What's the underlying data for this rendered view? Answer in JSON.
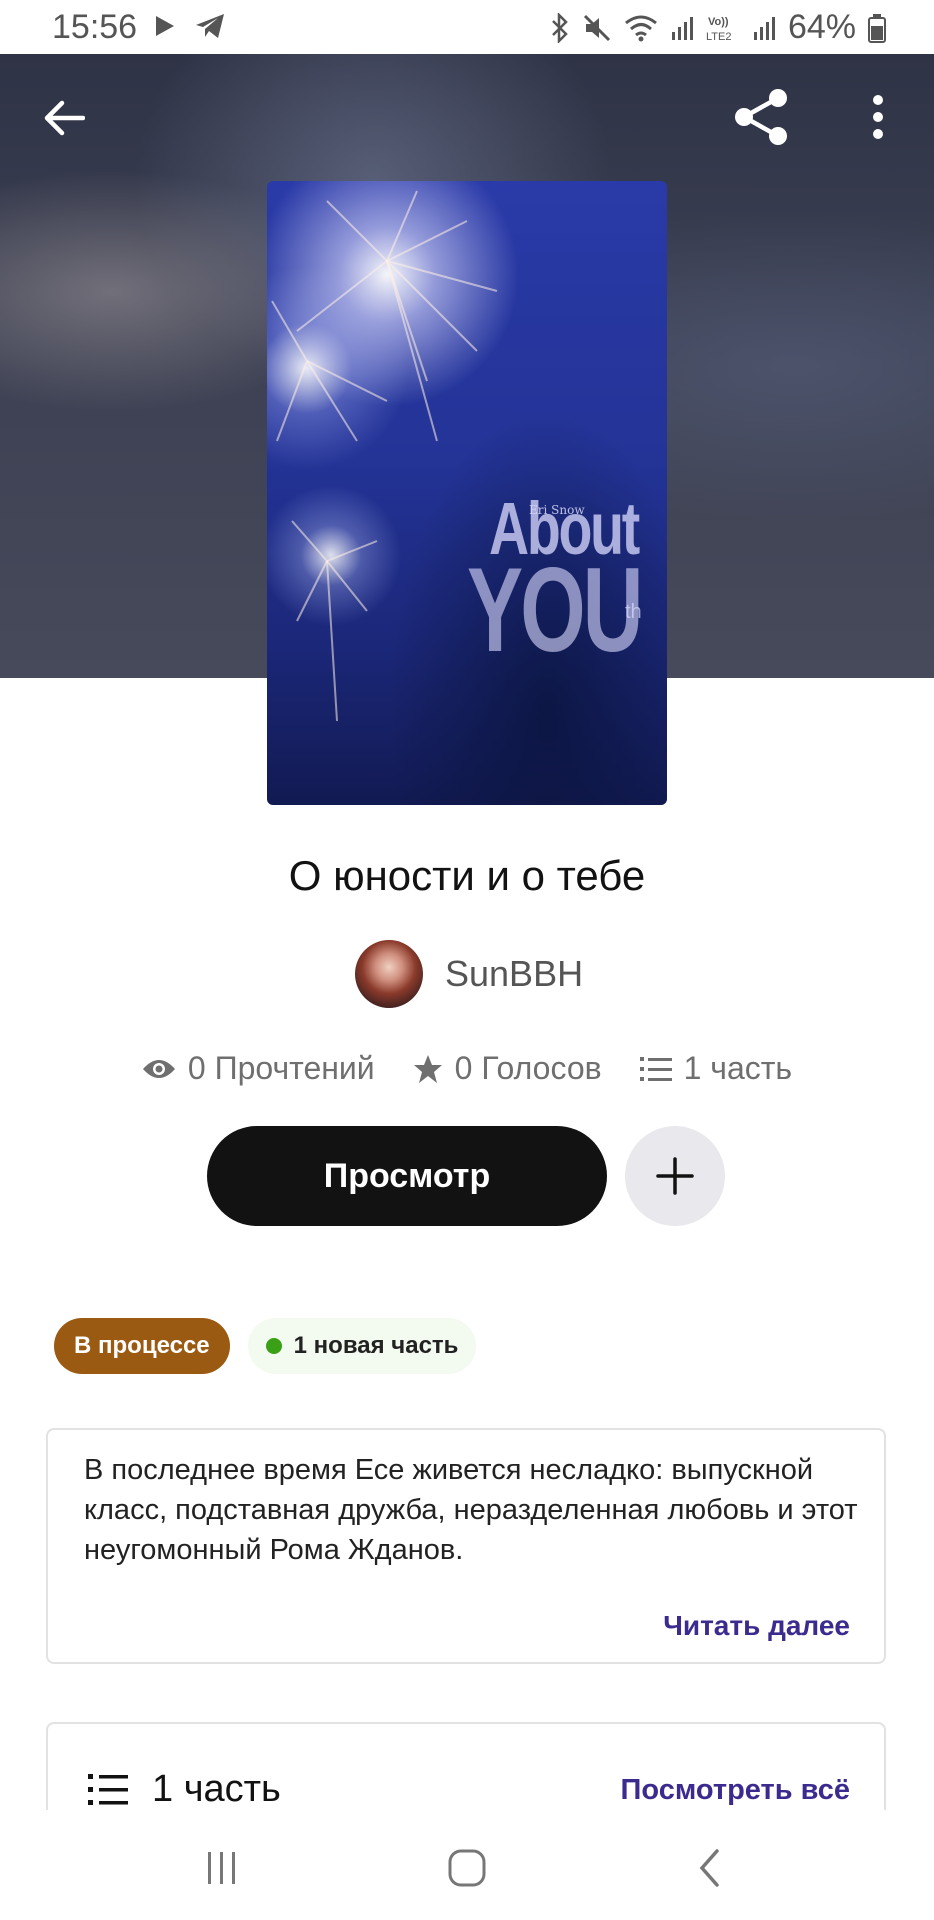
{
  "status_bar": {
    "time": "15:56",
    "battery": "64%",
    "icons": [
      "play-icon",
      "telegram-icon",
      "bluetooth-icon",
      "mute-icon",
      "wifi-icon",
      "signal-icon",
      "volte-icon",
      "signal-icon",
      "battery-icon"
    ],
    "volte_label": "Vo)) LTE2"
  },
  "toolbar": {
    "icons": [
      "back-arrow-icon",
      "share-icon",
      "more-vertical-icon"
    ]
  },
  "cover": {
    "author_text": "Eri Snow",
    "title_line1": "About",
    "title_line2": "YOU",
    "suffix": "th"
  },
  "story": {
    "title": "О юности и о тебе",
    "author": "SunBBH",
    "reads": "0 Прочтений",
    "votes": "0 Голосов",
    "parts": "1 часть"
  },
  "actions": {
    "read_label": "Просмотр",
    "add_icon": "plus-icon"
  },
  "badges": {
    "status": "В процессе",
    "new_parts": "1 новая часть"
  },
  "description": {
    "text": "В последнее время Есе живется несладко:  выпускной класс, подставная дружба, неразделенная любовь и этот неугомонный Рома Жданов.",
    "read_more": "Читать далее"
  },
  "parts_section": {
    "title": "1 часть",
    "see_all": "Посмотреть всё"
  },
  "colors": {
    "accent": "#3b2b8f",
    "status_badge": "#9a5a12",
    "new_dot": "#3aa015",
    "primary_button": "#121212"
  },
  "nav_bar": {
    "icons": [
      "recent-apps-icon",
      "home-icon",
      "back-icon"
    ]
  }
}
